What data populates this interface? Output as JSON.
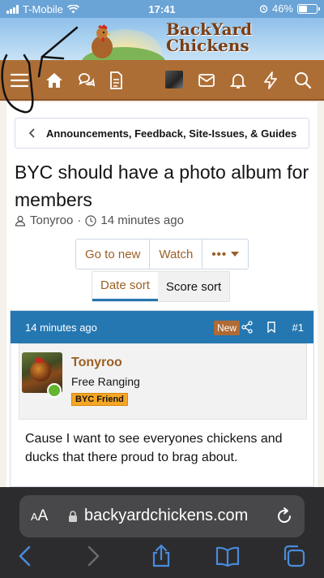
{
  "status_bar": {
    "carrier": "T-Mobile",
    "time": "17:41",
    "battery": "46%"
  },
  "header": {
    "logo_text_line1": "BackYard",
    "logo_text_line2": "Chickens"
  },
  "nav": {
    "icons": [
      "menu-icon",
      "home-icon",
      "chat-icon",
      "document-icon",
      "avatar",
      "mail-icon",
      "bell-icon",
      "bolt-icon",
      "search-icon"
    ]
  },
  "breadcrumb": {
    "label": "Announcements, Feedback, Site-Issues, & Guides"
  },
  "thread": {
    "title": "BYC should have a photo album for members",
    "author": "Tonyroo",
    "separator": "·",
    "time": "14 minutes ago"
  },
  "actions": {
    "go_to_new": "Go to new",
    "watch": "Watch",
    "more": "•••"
  },
  "sort": {
    "date": "Date sort",
    "score": "Score sort"
  },
  "post": {
    "time": "14 minutes ago",
    "badge": "New",
    "number": "#1",
    "username": "Tonyroo",
    "user_title": "Free Ranging",
    "user_badge": "BYC Friend",
    "body": "Cause I want to see everyones chickens and ducks that there proud to brag about."
  },
  "browser": {
    "aa_small": "A",
    "aa_large": "A",
    "url": "backyardchickens.com"
  },
  "colors": {
    "nav": "#ad6e35",
    "post_header": "#2577b1",
    "link": "#9b5f25",
    "safari": "#2c2c2e"
  }
}
